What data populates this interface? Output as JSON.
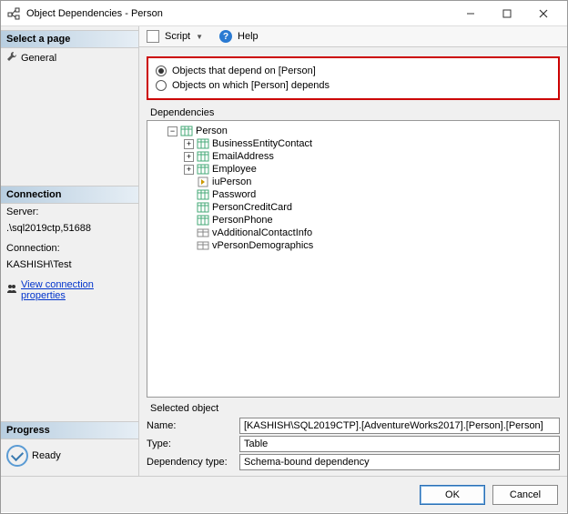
{
  "window": {
    "title": "Object Dependencies - Person"
  },
  "left": {
    "select_page": "Select a page",
    "general": "General",
    "connection_head": "Connection",
    "server_label": "Server:",
    "server_value": ".\\sql2019ctp,51688",
    "connection_label": "Connection:",
    "connection_value": "KASHISH\\Test",
    "view_conn_props": "View connection properties",
    "progress_head": "Progress",
    "ready": "Ready"
  },
  "toolbar": {
    "script": "Script",
    "help": "Help"
  },
  "radios": {
    "depend_on": "Objects that depend on [Person]",
    "depends": "Objects on which [Person] depends"
  },
  "group": {
    "dependencies": "Dependencies",
    "selected_object": "Selected object"
  },
  "tree": {
    "root": "Person",
    "c1": "BusinessEntityContact",
    "c2": "EmailAddress",
    "c3": "Employee",
    "c4": "iuPerson",
    "c5": "Password",
    "c6": "PersonCreditCard",
    "c7": "PersonPhone",
    "c8": "vAdditionalContactInfo",
    "c9": "vPersonDemographics"
  },
  "selected": {
    "name_label": "Name:",
    "name_value": "[KASHISH\\SQL2019CTP].[AdventureWorks2017].[Person].[Person]",
    "type_label": "Type:",
    "type_value": "Table",
    "dep_type_label": "Dependency type:",
    "dep_type_value": "Schema-bound dependency"
  },
  "buttons": {
    "ok": "OK",
    "cancel": "Cancel"
  }
}
